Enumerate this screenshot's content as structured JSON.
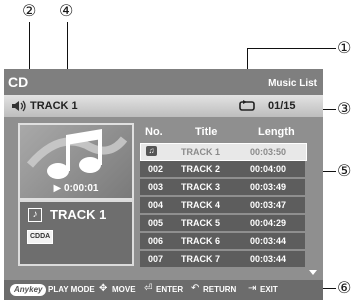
{
  "callouts": [
    "①",
    "②",
    "③",
    "④",
    "⑤",
    "⑥"
  ],
  "screen": {
    "title": "CD",
    "menu_label": "Music List",
    "now_playing": {
      "track": "TRACK 1",
      "counter": "01/15"
    },
    "play_time": "▶ 0:00:01",
    "info": {
      "track": "TRACK 1",
      "format_badge": "CDDA"
    },
    "list": {
      "headers": [
        "No.",
        "Title",
        "Length"
      ],
      "rows": [
        {
          "no": "",
          "title": "TRACK 1",
          "length": "00:03:50"
        },
        {
          "no": "002",
          "title": "TRACK 2",
          "length": "00:04:00"
        },
        {
          "no": "003",
          "title": "TRACK 3",
          "length": "00:03:49"
        },
        {
          "no": "004",
          "title": "TRACK 4",
          "length": "00:03:47"
        },
        {
          "no": "005",
          "title": "TRACK 5",
          "length": "00:04:29"
        },
        {
          "no": "006",
          "title": "TRACK 6",
          "length": "00:03:44"
        },
        {
          "no": "007",
          "title": "TRACK 7",
          "length": "00:03:44"
        }
      ]
    },
    "bottom_bar": {
      "anykey": "Anykey",
      "play_mode": "PLAY MODE",
      "move": "MOVE",
      "enter": "ENTER",
      "return": "RETURN",
      "exit": "EXIT"
    }
  }
}
